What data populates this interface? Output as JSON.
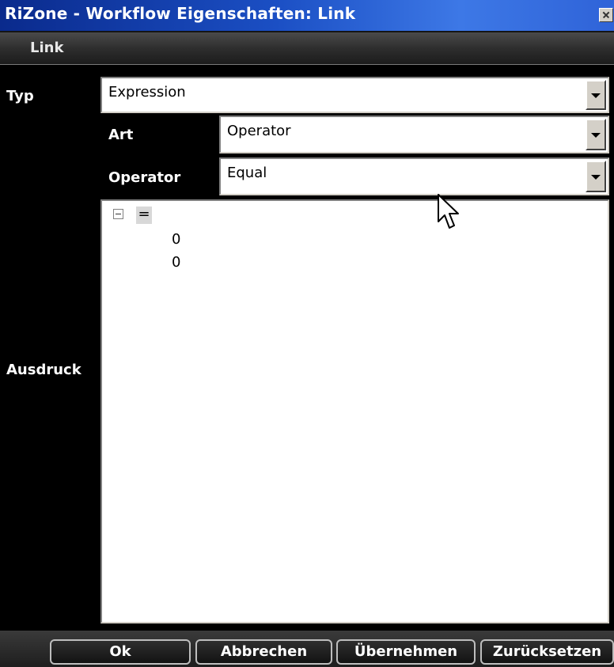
{
  "window": {
    "title": "RiZone - Workflow Eigenschaften: Link"
  },
  "tabs": [
    {
      "label": "Link"
    }
  ],
  "form": {
    "typ": {
      "label": "Typ",
      "value": "Expression"
    },
    "art": {
      "label": "Art",
      "value": "Operator"
    },
    "operator": {
      "label": "Operator",
      "value": "Equal"
    },
    "ausdruck": {
      "label": "Ausdruck",
      "tree": {
        "root": "=",
        "children": [
          "0",
          "0"
        ]
      }
    }
  },
  "buttons": {
    "ok": "Ok",
    "cancel": "Abbrechen",
    "apply": "Übernehmen",
    "reset": "Zurücksetzen"
  }
}
